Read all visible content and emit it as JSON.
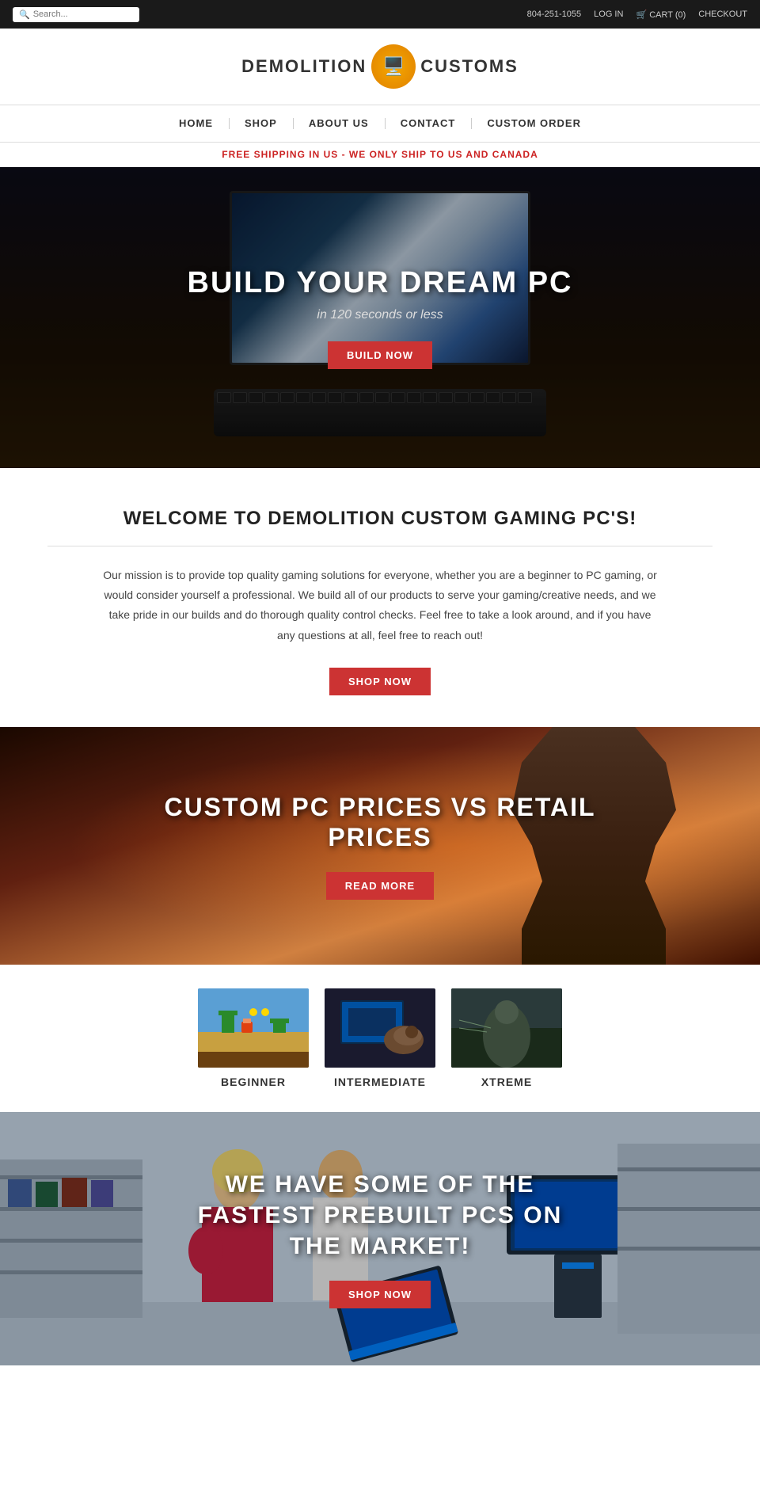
{
  "topbar": {
    "search_placeholder": "Search...",
    "phone": "804-251-1055",
    "log_in": "LOG IN",
    "cart": "CART",
    "cart_count": "(0)",
    "checkout": "CHECKOUT"
  },
  "logo": {
    "text_left": "DEMOLITION",
    "icon": "🖥️",
    "text_right": "CUSTOMS"
  },
  "nav": {
    "items": [
      {
        "label": "HOME",
        "active": true
      },
      {
        "label": "SHOP",
        "active": false
      },
      {
        "label": "ABOUT US",
        "active": false
      },
      {
        "label": "CONTACT",
        "active": false
      },
      {
        "label": "CUSTOM ORDER",
        "active": false
      }
    ]
  },
  "shipping_banner": "FREE SHIPPING IN US - WE ONLY SHIP TO US AND CANADA",
  "hero": {
    "title": "BUILD YOUR DREAM PC",
    "subtitle": "in 120 seconds or less",
    "button": "BUILD NOW"
  },
  "welcome": {
    "title": "WELCOME TO DEMOLITION CUSTOM GAMING PC'S!",
    "text": "Our mission is to provide top quality gaming solutions for everyone, whether you are a beginner to PC gaming, or would consider yourself a professional. We build all of our products to serve your gaming/creative needs, and we take pride in our builds and do thorough quality control checks. Feel free to take a look around, and if you have any questions at all, feel free to reach out!",
    "button": "SHOP NOW"
  },
  "custom_pc_banner": {
    "title": "CUSTOM PC PRICES VS RETAIL\nPRICES",
    "button": "READ MORE"
  },
  "categories": [
    {
      "label": "BEGINNER",
      "type": "beginner"
    },
    {
      "label": "INTERMEDIATE",
      "type": "intermediate"
    },
    {
      "label": "XTREME",
      "type": "xtreme"
    }
  ],
  "fastest_banner": {
    "title": "WE HAVE SOME OF THE FASTEST PREBUILT PCS ON THE MARKET!",
    "button": "SHOP NOW"
  }
}
